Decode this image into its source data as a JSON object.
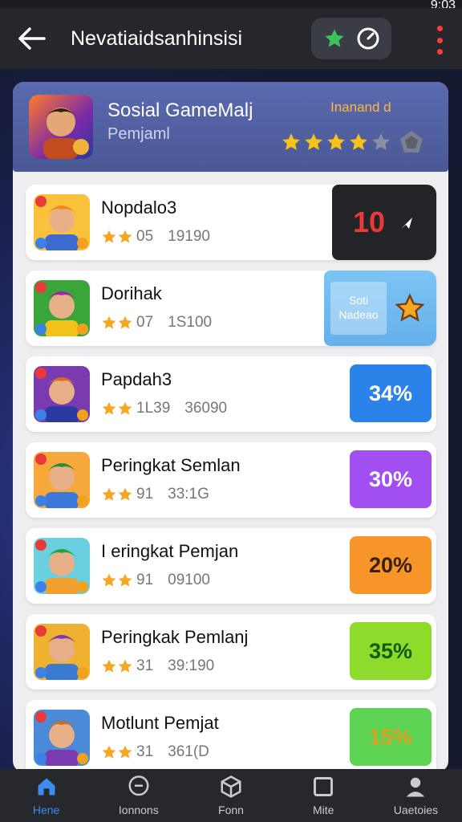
{
  "status": {
    "time": "9:03"
  },
  "appbar": {
    "title": "Nevatiaidsanhinsisi"
  },
  "header": {
    "title": "Sosial GameMalj",
    "subtitle": "Pemjaml",
    "label": "Inanand d",
    "stars_filled": 4,
    "stars_total": 5
  },
  "items": [
    {
      "name": "Nopdalo3",
      "rating": "05",
      "score": "19190",
      "tile_text": "10",
      "tile_type": "rank"
    },
    {
      "name": "Dorihak",
      "rating": "07",
      "score": "1S100",
      "tile_line1": "Soti",
      "tile_line2": "Nadeao",
      "tile_type": "social"
    },
    {
      "name": "Papdah3",
      "rating": "1L39",
      "score": "36090",
      "tile_text": "34%",
      "tile_type": "pct",
      "tile_color": "#2b82e8",
      "tile_text_color": "#ffffff"
    },
    {
      "name": "Peringkat Semlan",
      "rating": "91",
      "score": "33:1G",
      "tile_text": "30%",
      "tile_type": "pct",
      "tile_color": "#a14ff0",
      "tile_text_color": "#ffffff"
    },
    {
      "name": "I eringkat Pemjan",
      "rating": "91",
      "score": "09100",
      "tile_text": "20%",
      "tile_type": "pct",
      "tile_color": "#f7942a",
      "tile_text_color": "#3a2000"
    },
    {
      "name": "Peringkak Pemlanj",
      "rating": "31",
      "score": "39:190",
      "tile_text": "35%",
      "tile_type": "pct",
      "tile_color": "#8edb2c",
      "tile_text_color": "#155a10"
    },
    {
      "name": "Motlunt Pemjat",
      "rating": "31",
      "score": "361(D",
      "tile_text": "15%",
      "tile_type": "pct",
      "tile_color": "#5ed454",
      "tile_text_color": "#e0a020"
    }
  ],
  "nav": [
    {
      "label": "Hene",
      "icon": "home-icon",
      "active": true
    },
    {
      "label": "Ionnons",
      "icon": "chat-icon",
      "active": false
    },
    {
      "label": "Fonn",
      "icon": "cube-icon",
      "active": false
    },
    {
      "label": "Mite",
      "icon": "square-icon",
      "active": false
    },
    {
      "label": "Uaetoies",
      "icon": "profile-icon",
      "active": false
    }
  ],
  "colors": {
    "accent": "#3d8cf0",
    "star": "#f5a623",
    "rank_text": "#e83a3a"
  }
}
